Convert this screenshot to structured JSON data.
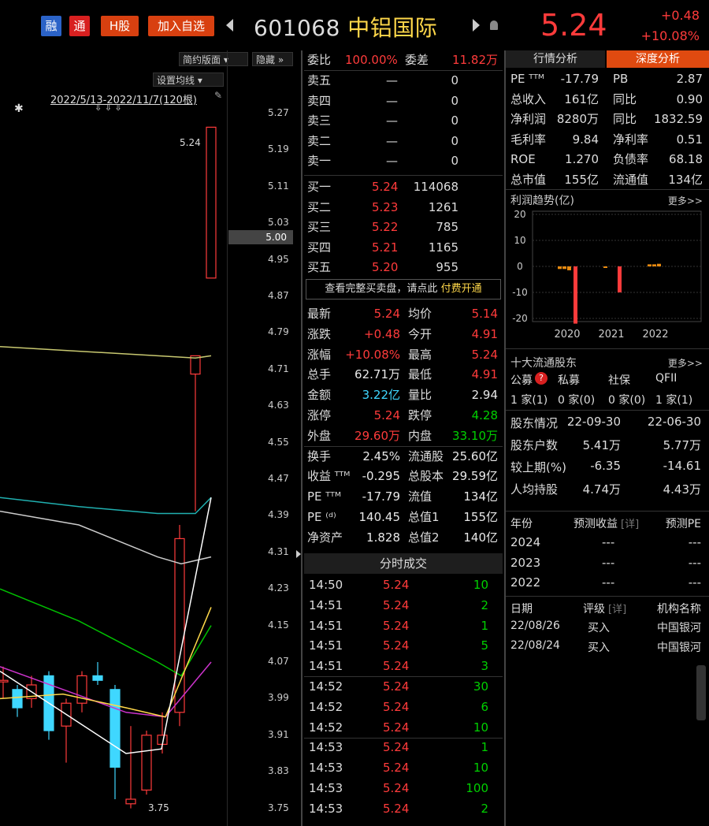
{
  "topbar": {
    "btn_rong": "融",
    "btn_tong": "通",
    "btn_hgu": "H股",
    "btn_add": "加入自选",
    "code": "601068",
    "name": "中铝国际",
    "price": "5.24",
    "change": "+0.48",
    "change_pct": "+10.08%"
  },
  "chart": {
    "btn_simple": "简约版面",
    "btn_hide": "隐藏",
    "btn_ma": "设置均线",
    "date_range": "2022/5/13-2022/11/7(120根)",
    "high_label": "5.24",
    "low_label": "3.75",
    "current_box": "5.00",
    "ticks": [
      "5.27",
      "5.19",
      "5.11",
      "5.03",
      "4.95",
      "4.87",
      "4.79",
      "4.71",
      "4.63",
      "4.55",
      "4.47",
      "4.39",
      "4.31",
      "4.23",
      "4.15",
      "4.07",
      "3.99",
      "3.91",
      "3.83",
      "3.75"
    ],
    "colors": {
      "up": "#ff3b3b",
      "down": "#3fd7ff",
      "ma5": "#ffffff",
      "ma10": "#ffd84a",
      "ma20": "#cc33cc",
      "ma30": "#00c000",
      "ma60": "#cccccc",
      "ma120": "#20b0b0",
      "ma250": "#c8c870"
    }
  },
  "orderbook": {
    "weibi_label": "委比",
    "weibi": "100.00%",
    "weicha_label": "委差",
    "weicha": "11.82万",
    "asks": [
      {
        "label": "卖五",
        "price": "—",
        "vol": "0"
      },
      {
        "label": "卖四",
        "price": "—",
        "vol": "0"
      },
      {
        "label": "卖三",
        "price": "—",
        "vol": "0"
      },
      {
        "label": "卖二",
        "price": "—",
        "vol": "0"
      },
      {
        "label": "卖一",
        "price": "—",
        "vol": "0"
      }
    ],
    "bids": [
      {
        "label": "买一",
        "price": "5.24",
        "vol": "114068"
      },
      {
        "label": "买二",
        "price": "5.23",
        "vol": "1261"
      },
      {
        "label": "买三",
        "price": "5.22",
        "vol": "785"
      },
      {
        "label": "买四",
        "price": "5.21",
        "vol": "1165"
      },
      {
        "label": "买五",
        "price": "5.20",
        "vol": "955"
      }
    ],
    "notice": "查看完整买卖盘，请点此",
    "notice_link": "付费开通"
  },
  "quote": {
    "rows": [
      {
        "l1": "最新",
        "v1": "5.24",
        "c1": "red",
        "l2": "均价",
        "v2": "5.14",
        "c2": "red"
      },
      {
        "l1": "涨跌",
        "v1": "+0.48",
        "c1": "red",
        "l2": "今开",
        "v2": "4.91",
        "c2": "red"
      },
      {
        "l1": "涨幅",
        "v1": "+10.08%",
        "c1": "red",
        "l2": "最高",
        "v2": "5.24",
        "c2": "red"
      },
      {
        "l1": "总手",
        "v1": "62.71万",
        "c1": "white",
        "l2": "最低",
        "v2": "4.91",
        "c2": "red"
      },
      {
        "l1": "金额",
        "v1": "3.22亿",
        "c1": "cyan",
        "l2": "量比",
        "v2": "2.94",
        "c2": "white"
      },
      {
        "l1": "涨停",
        "v1": "5.24",
        "c1": "red",
        "l2": "跌停",
        "v2": "4.28",
        "c2": "green"
      },
      {
        "l1": "外盘",
        "v1": "29.60万",
        "c1": "red",
        "l2": "内盘",
        "v2": "33.10万",
        "c2": "green"
      },
      {
        "l1": "换手",
        "v1": "2.45%",
        "c1": "white",
        "l2": "流通股",
        "v2": "25.60亿",
        "c2": "white"
      },
      {
        "l1": "收益 ᵀᵀᴹ",
        "v1": "-0.295",
        "c1": "white",
        "l2": "总股本",
        "v2": "29.59亿",
        "c2": "white"
      },
      {
        "l1": "PE ᵀᵀᴹ",
        "v1": "-17.79",
        "c1": "white",
        "l2": "流值",
        "v2": "134亿",
        "c2": "white"
      },
      {
        "l1": "PE ⁽ᵈ⁾",
        "v1": "140.45",
        "c1": "white",
        "l2": "总值1",
        "v2": "155亿",
        "c2": "white"
      },
      {
        "l1": "净资产",
        "v1": "1.828",
        "c1": "white",
        "l2": "总值2",
        "v2": "140亿",
        "c2": "white"
      }
    ]
  },
  "ticks": {
    "title": "分时成交",
    "rows": [
      {
        "t": "14:50",
        "p": "5.24",
        "v": "10"
      },
      {
        "t": "14:51",
        "p": "5.24",
        "v": "2"
      },
      {
        "t": "14:51",
        "p": "5.24",
        "v": "1"
      },
      {
        "t": "14:51",
        "p": "5.24",
        "v": "5"
      },
      {
        "t": "14:51",
        "p": "5.24",
        "v": "3"
      },
      {
        "t": "14:52",
        "p": "5.24",
        "v": "30"
      },
      {
        "t": "14:52",
        "p": "5.24",
        "v": "6"
      },
      {
        "t": "14:52",
        "p": "5.24",
        "v": "10"
      },
      {
        "t": "14:53",
        "p": "5.24",
        "v": "1"
      },
      {
        "t": "14:53",
        "p": "5.24",
        "v": "10"
      },
      {
        "t": "14:53",
        "p": "5.24",
        "v": "100"
      },
      {
        "t": "14:53",
        "p": "5.24",
        "v": "2"
      }
    ]
  },
  "right": {
    "tab1": "行情分析",
    "tab2": "深度分析",
    "fund": [
      {
        "l1": "PE ᵀᵀᴹ",
        "v1": "-17.79",
        "l2": "PB",
        "v2": "2.87"
      },
      {
        "l1": "总收入",
        "v1": "161亿",
        "l2": "同比",
        "v2": "0.90"
      },
      {
        "l1": "净利润",
        "v1": "8280万",
        "l2": "同比",
        "v2": "1832.59"
      },
      {
        "l1": "毛利率",
        "v1": "9.84",
        "l2": "净利率",
        "v2": "0.51"
      },
      {
        "l1": "ROE",
        "v1": "1.270",
        "l2": "负债率",
        "v2": "68.18"
      },
      {
        "l1": "总市值",
        "v1": "155亿",
        "l2": "流通值",
        "v2": "134亿"
      }
    ],
    "profit_title": "利润趋势(亿)",
    "more": "更多>>",
    "profit_axis": [
      "20",
      "10",
      "0",
      "-10",
      "-20"
    ],
    "profit_years": [
      "2020",
      "2021",
      "2022"
    ],
    "holders_title": "十大流通股东",
    "holder_types": [
      "公募",
      "私募",
      "社保",
      "QFII"
    ],
    "holder_badge": "?",
    "holder_counts": [
      "1 家(1)",
      "0 家(0)",
      "0 家(0)",
      "1 家(1)"
    ],
    "holder_table": [
      {
        "l": "股东情况",
        "a": "22-09-30",
        "b": "22-06-30"
      },
      {
        "l": "股东户数",
        "a": "5.41万",
        "b": "5.77万"
      },
      {
        "l": "较上期(%)",
        "a": "-6.35",
        "b": "-14.61"
      },
      {
        "l": "人均持股",
        "a": "4.74万",
        "b": "4.43万"
      }
    ],
    "forecast_header": [
      "年份",
      "预测收益",
      "[详]",
      "预测PE"
    ],
    "forecast_rows": [
      {
        "y": "2024",
        "a": "---",
        "b": "---"
      },
      {
        "y": "2023",
        "a": "---",
        "b": "---"
      },
      {
        "y": "2022",
        "a": "---",
        "b": "---"
      }
    ],
    "rating_header": [
      "日期",
      "评级",
      "[详]",
      "机构名称"
    ],
    "rating_rows": [
      {
        "d": "22/08/26",
        "r": "买入",
        "o": "中国银河"
      },
      {
        "d": "22/08/24",
        "r": "买入",
        "o": "中国银河"
      }
    ]
  }
}
